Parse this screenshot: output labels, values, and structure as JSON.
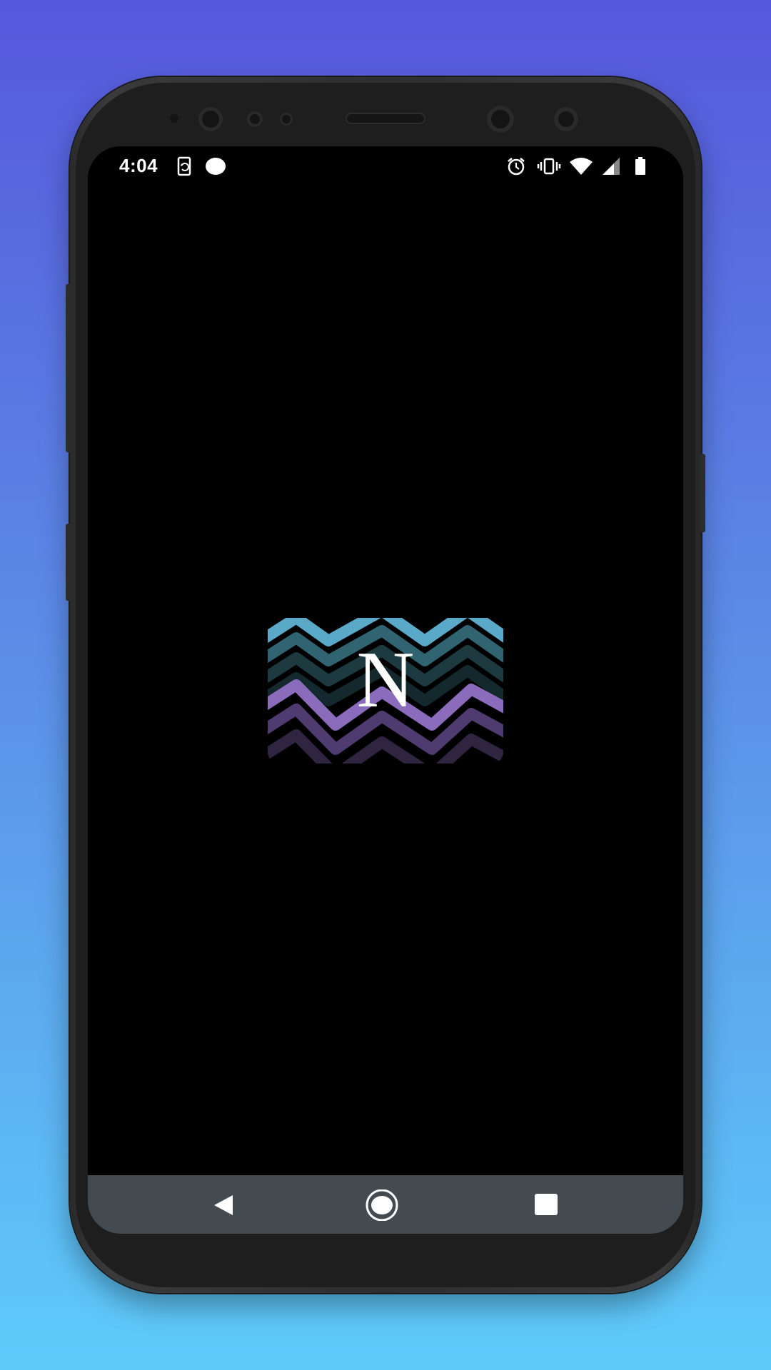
{
  "colors": {
    "background_top": "#5658dc",
    "background_bottom": "#5ecbfa",
    "screen": "#000000",
    "nav_bar": "#434b51",
    "logo_stripes": [
      "#5aa9c8",
      "#2f6470",
      "#1d3a40",
      "#14292d",
      "#8b6bbc",
      "#4f3b6f",
      "#2f2540"
    ]
  },
  "status_bar": {
    "time": "4:04",
    "left_icons": [
      "screen-rotate-icon",
      "circle-dot-icon"
    ],
    "right_icons": [
      "alarm-icon",
      "vibrate-icon",
      "wifi-icon",
      "signal-icon",
      "battery-icon"
    ]
  },
  "splash": {
    "logo_icon": "zigzag-stripes-logo",
    "logo_letter": "N"
  },
  "navigation_bar": {
    "buttons": [
      "back-icon",
      "home-icon",
      "recents-icon"
    ]
  }
}
